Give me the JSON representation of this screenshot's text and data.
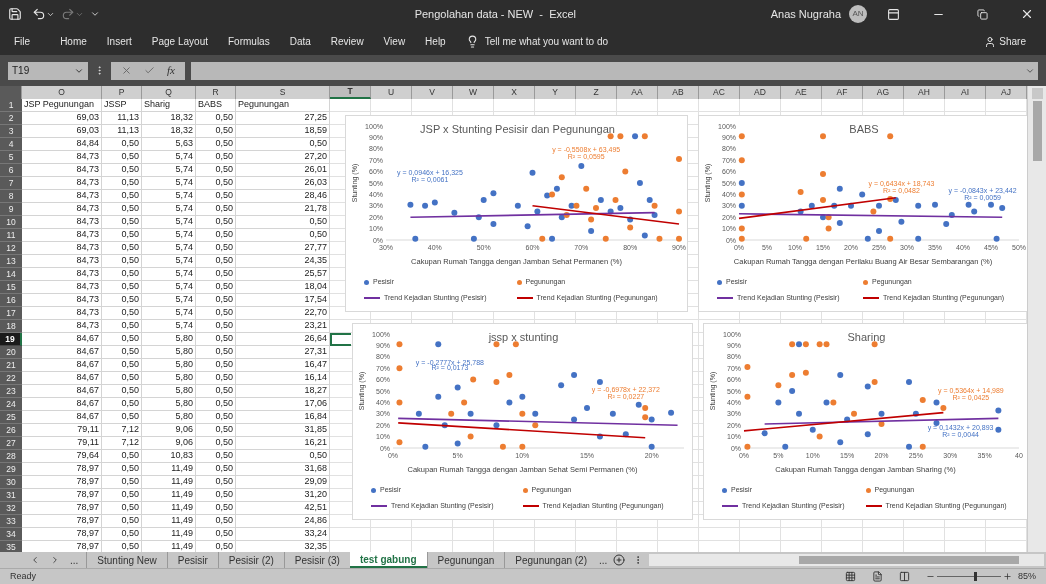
{
  "window": {
    "title": "Pengolahan data - NEW  -  Excel",
    "user": "Anas Nugraha",
    "user_initials": "AN"
  },
  "menu": [
    {
      "label": "File"
    },
    {
      "label": "Home"
    },
    {
      "label": "Insert"
    },
    {
      "label": "Page Layout"
    },
    {
      "label": "Formulas"
    },
    {
      "label": "Data"
    },
    {
      "label": "Review"
    },
    {
      "label": "View"
    },
    {
      "label": "Help"
    }
  ],
  "tell_me": {
    "placeholder": "Tell me what you want to do"
  },
  "share": "Share",
  "formula_bar": {
    "name_box": "T19",
    "function_label": "fx"
  },
  "columns": [
    {
      "label": "O",
      "selected": false
    },
    {
      "label": "P",
      "selected": false
    },
    {
      "label": "Q",
      "selected": false
    },
    {
      "label": "R",
      "selected": false
    },
    {
      "label": "S",
      "selected": false
    },
    {
      "label": "T",
      "selected": true
    },
    {
      "label": "U",
      "selected": false
    },
    {
      "label": "V",
      "selected": false
    },
    {
      "label": "W",
      "selected": false
    },
    {
      "label": "X",
      "selected": false
    },
    {
      "label": "Y",
      "selected": false
    },
    {
      "label": "Z",
      "selected": false
    },
    {
      "label": "AA",
      "selected": false
    },
    {
      "label": "AB",
      "selected": false
    },
    {
      "label": "AC",
      "selected": false
    },
    {
      "label": "AD",
      "selected": false
    },
    {
      "label": "AE",
      "selected": false
    },
    {
      "label": "AF",
      "selected": false
    },
    {
      "label": "AG",
      "selected": false
    },
    {
      "label": "AH",
      "selected": false
    },
    {
      "label": "AI",
      "selected": false
    },
    {
      "label": "AJ",
      "selected": false
    }
  ],
  "rows": [
    {
      "number": "1",
      "selected": false,
      "kind": "text",
      "cells": [
        "JSP Pegunungan",
        "JSSP",
        "Sharig",
        "BABS",
        "Pegunungan"
      ]
    },
    {
      "number": "2",
      "selected": false,
      "kind": "number",
      "cells": [
        "69,03",
        "11,13",
        "18,32",
        "0,50",
        "27,25"
      ]
    },
    {
      "number": "3",
      "selected": false,
      "kind": "number",
      "cells": [
        "69,03",
        "11,13",
        "18,32",
        "0,50",
        "18,59"
      ]
    },
    {
      "number": "4",
      "selected": false,
      "kind": "number",
      "cells": [
        "84,84",
        "0,50",
        "5,63",
        "0,50",
        "0,50"
      ]
    },
    {
      "number": "5",
      "selected": false,
      "kind": "number",
      "cells": [
        "84,73",
        "0,50",
        "5,74",
        "0,50",
        "27,20"
      ]
    },
    {
      "number": "6",
      "selected": false,
      "kind": "number",
      "cells": [
        "84,73",
        "0,50",
        "5,74",
        "0,50",
        "26,01"
      ]
    },
    {
      "number": "7",
      "selected": false,
      "kind": "number",
      "cells": [
        "84,73",
        "0,50",
        "5,74",
        "0,50",
        "26,03"
      ]
    },
    {
      "number": "8",
      "selected": false,
      "kind": "number",
      "cells": [
        "84,73",
        "0,50",
        "5,74",
        "0,50",
        "28,46"
      ]
    },
    {
      "number": "9",
      "selected": false,
      "kind": "number",
      "cells": [
        "84,73",
        "0,50",
        "5,74",
        "0,50",
        "21,78"
      ]
    },
    {
      "number": "10",
      "selected": false,
      "kind": "number",
      "cells": [
        "84,73",
        "0,50",
        "5,74",
        "0,50",
        "0,50"
      ]
    },
    {
      "number": "11",
      "selected": false,
      "kind": "number",
      "cells": [
        "84,73",
        "0,50",
        "5,74",
        "0,50",
        "0,50"
      ]
    },
    {
      "number": "12",
      "selected": false,
      "kind": "number",
      "cells": [
        "84,73",
        "0,50",
        "5,74",
        "0,50",
        "27,77"
      ]
    },
    {
      "number": "13",
      "selected": false,
      "kind": "number",
      "cells": [
        "84,73",
        "0,50",
        "5,74",
        "0,50",
        "24,35"
      ]
    },
    {
      "number": "14",
      "selected": false,
      "kind": "number",
      "cells": [
        "84,73",
        "0,50",
        "5,74",
        "0,50",
        "25,57"
      ]
    },
    {
      "number": "15",
      "selected": false,
      "kind": "number",
      "cells": [
        "84,73",
        "0,50",
        "5,74",
        "0,50",
        "18,04"
      ]
    },
    {
      "number": "16",
      "selected": false,
      "kind": "number",
      "cells": [
        "84,73",
        "0,50",
        "5,74",
        "0,50",
        "17,54"
      ]
    },
    {
      "number": "17",
      "selected": false,
      "kind": "number",
      "cells": [
        "84,73",
        "0,50",
        "5,74",
        "0,50",
        "22,70"
      ]
    },
    {
      "number": "18",
      "selected": false,
      "kind": "number",
      "cells": [
        "84,73",
        "0,50",
        "5,74",
        "0,50",
        "23,21"
      ]
    },
    {
      "number": "19",
      "selected": true,
      "kind": "number",
      "cells": [
        "84,67",
        "0,50",
        "5,80",
        "0,50",
        "26,64"
      ]
    },
    {
      "number": "20",
      "selected": false,
      "kind": "number",
      "cells": [
        "84,67",
        "0,50",
        "5,80",
        "0,50",
        "27,31"
      ]
    },
    {
      "number": "21",
      "selected": false,
      "kind": "number",
      "cells": [
        "84,67",
        "0,50",
        "5,80",
        "0,50",
        "16,47"
      ]
    },
    {
      "number": "22",
      "selected": false,
      "kind": "number",
      "cells": [
        "84,67",
        "0,50",
        "5,80",
        "0,50",
        "16,14"
      ]
    },
    {
      "number": "23",
      "selected": false,
      "kind": "number",
      "cells": [
        "84,67",
        "0,50",
        "5,80",
        "0,50",
        "18,27"
      ]
    },
    {
      "number": "24",
      "selected": false,
      "kind": "number",
      "cells": [
        "84,67",
        "0,50",
        "5,80",
        "0,50",
        "17,06"
      ]
    },
    {
      "number": "25",
      "selected": false,
      "kind": "number",
      "cells": [
        "84,67",
        "0,50",
        "5,80",
        "0,50",
        "16,84"
      ]
    },
    {
      "number": "26",
      "selected": false,
      "kind": "number",
      "cells": [
        "79,11",
        "7,12",
        "9,06",
        "0,50",
        "31,85"
      ]
    },
    {
      "number": "27",
      "selected": false,
      "kind": "number",
      "cells": [
        "79,11",
        "7,12",
        "9,06",
        "0,50",
        "16,21"
      ]
    },
    {
      "number": "28",
      "selected": false,
      "kind": "number",
      "cells": [
        "79,64",
        "0,50",
        "10,83",
        "0,50",
        "0,50"
      ]
    },
    {
      "number": "29",
      "selected": false,
      "kind": "number",
      "cells": [
        "78,97",
        "0,50",
        "11,49",
        "0,50",
        "31,68"
      ]
    },
    {
      "number": "30",
      "selected": false,
      "kind": "number",
      "cells": [
        "78,97",
        "0,50",
        "11,49",
        "0,50",
        "29,09"
      ]
    },
    {
      "number": "31",
      "selected": false,
      "kind": "number",
      "cells": [
        "78,97",
        "0,50",
        "11,49",
        "0,50",
        "31,20"
      ]
    },
    {
      "number": "32",
      "selected": false,
      "kind": "number",
      "cells": [
        "78,97",
        "0,50",
        "11,49",
        "0,50",
        "42,51"
      ]
    },
    {
      "number": "33",
      "selected": false,
      "kind": "number",
      "cells": [
        "78,97",
        "0,50",
        "11,49",
        "0,50",
        "24,86"
      ]
    },
    {
      "number": "34",
      "selected": false,
      "kind": "number",
      "cells": [
        "78,97",
        "0,50",
        "11,49",
        "0,50",
        "33,24"
      ]
    },
    {
      "number": "35",
      "selected": false,
      "kind": "number",
      "cells": [
        "78,97",
        "0,50",
        "11,49",
        "0,50",
        "32,35"
      ]
    }
  ],
  "charts": [
    {
      "chart_data": {
        "type": "scatter",
        "title": "JSP x Stunting Pesisir dan Pegunungan",
        "xlabel": "Cakupan Rumah Tangga dengan Jamban Sehat Permanen (%)",
        "ylabel": "Stunting (%)",
        "xlim": [
          30,
          90
        ],
        "ylim": [
          0,
          100
        ],
        "xticks": [
          {
            "value": 30,
            "label": "30%"
          },
          {
            "value": 40,
            "label": "40%"
          },
          {
            "value": 50,
            "label": "50%"
          },
          {
            "value": 60,
            "label": "60%"
          },
          {
            "value": 70,
            "label": "70%"
          },
          {
            "value": 80,
            "label": "80%"
          },
          {
            "value": 90,
            "label": "90%"
          }
        ],
        "yticks": [
          {
            "value": 0,
            "label": "0%"
          },
          {
            "value": 10,
            "label": "10%"
          },
          {
            "value": 20,
            "label": "20%"
          },
          {
            "value": 30,
            "label": "30%"
          },
          {
            "value": 40,
            "label": "40%"
          },
          {
            "value": 50,
            "label": "50%"
          },
          {
            "value": 60,
            "label": "60%"
          },
          {
            "value": 70,
            "label": "70%"
          },
          {
            "value": 80,
            "label": "80%"
          },
          {
            "value": 90,
            "label": "90%"
          },
          {
            "value": 100,
            "label": "100%"
          }
        ],
        "x": [
          35,
          36,
          38,
          40,
          44,
          48,
          49,
          50,
          52,
          52,
          57,
          59,
          60,
          61,
          63,
          65,
          66,
          68,
          70,
          72,
          74,
          76,
          78,
          80,
          81,
          82,
          83,
          84,
          85,
          64,
          62,
          64,
          66,
          67,
          69,
          71,
          73,
          75,
          76,
          77,
          78,
          79,
          80,
          83,
          85,
          86,
          90,
          90,
          90,
          72,
          35,
          85,
          60,
          90
        ],
        "series": [
          {
            "name": "Pesisir",
            "type": "scatter",
            "color": "#4472c4",
            "values": [
              31,
              1,
              30,
              33,
              24,
              1,
              20,
              35,
              41,
              14,
              30,
              12,
              59,
              25,
              39,
              45,
              20,
              30,
              65,
              8,
              35,
              25,
              28,
              18,
              91,
              50,
              4,
              35,
              22,
              1,
              null,
              null,
              null,
              null,
              null,
              null,
              null,
              null,
              null,
              null,
              null,
              null,
              null,
              null,
              null,
              null,
              null,
              null,
              null,
              null,
              null,
              null,
              null,
              null
            ]
          },
          {
            "name": "Pegunungan",
            "type": "scatter",
            "color": "#ed7d31",
            "values": [
              null,
              null,
              null,
              null,
              null,
              null,
              null,
              null,
              null,
              null,
              null,
              null,
              null,
              null,
              null,
              null,
              null,
              null,
              null,
              null,
              null,
              null,
              null,
              null,
              null,
              null,
              null,
              null,
              null,
              null,
              1,
              40,
              55,
              22,
              30,
              45,
              28,
              1,
              91,
              35,
              91,
              60,
              11,
              91,
              30,
              1,
              71,
              25,
              1,
              18,
              null,
              null,
              null,
              null
            ]
          },
          {
            "name": "Trend Kejadian Stunting (Pesisir)",
            "type": "line",
            "color": "#7030a0",
            "values": [
              null,
              null,
              null,
              null,
              null,
              null,
              null,
              null,
              null,
              null,
              null,
              null,
              null,
              null,
              null,
              null,
              null,
              null,
              null,
              null,
              null,
              null,
              null,
              null,
              null,
              null,
              null,
              null,
              null,
              null,
              null,
              null,
              null,
              null,
              null,
              null,
              null,
              null,
              null,
              null,
              null,
              null,
              null,
              null,
              null,
              null,
              null,
              null,
              null,
              null,
              20,
              24,
              null,
              null
            ]
          },
          {
            "name": "Trend Kejadian Stunting (Pegunungan)",
            "type": "line",
            "color": "#c00000",
            "values": [
              null,
              null,
              null,
              null,
              null,
              null,
              null,
              null,
              null,
              null,
              null,
              null,
              null,
              null,
              null,
              null,
              null,
              null,
              null,
              null,
              null,
              null,
              null,
              null,
              null,
              null,
              null,
              null,
              null,
              null,
              null,
              null,
              null,
              null,
              null,
              null,
              null,
              null,
              null,
              null,
              null,
              null,
              null,
              null,
              null,
              null,
              null,
              null,
              null,
              null,
              null,
              null,
              30,
              14
            ]
          }
        ],
        "annotations": [
          "y = 0,0946x + 16,325",
          "R² = 0,0061",
          "y = -0,5508x + 63,495",
          "R² = 0,0595"
        ]
      }
    },
    {
      "chart_data": {
        "type": "scatter",
        "title": "BABS",
        "xlabel": "Cakupan Rumah Tangga dengan Perilaku Buang Air Besar Sembarangan (%)",
        "ylabel": "Stunting (%)",
        "xlim": [
          0,
          50
        ],
        "ylim": [
          0,
          100
        ],
        "xticks": [
          {
            "value": 0,
            "label": "0%"
          },
          {
            "value": 5,
            "label": "5%"
          },
          {
            "value": 10,
            "label": "10%"
          },
          {
            "value": 15,
            "label": "15%"
          },
          {
            "value": 20,
            "label": "20%"
          },
          {
            "value": 25,
            "label": "25%"
          },
          {
            "value": 30,
            "label": "30%"
          },
          {
            "value": 35,
            "label": "35%"
          },
          {
            "value": 40,
            "label": "40%"
          },
          {
            "value": 45,
            "label": "45%"
          },
          {
            "value": 50,
            "label": "50%"
          }
        ],
        "yticks": [
          {
            "value": 0,
            "label": "0%"
          },
          {
            "value": 10,
            "label": "10%"
          },
          {
            "value": 20,
            "label": "20%"
          },
          {
            "value": 30,
            "label": "30%"
          },
          {
            "value": 40,
            "label": "40%"
          },
          {
            "value": 50,
            "label": "50%"
          },
          {
            "value": 60,
            "label": "60%"
          },
          {
            "value": 70,
            "label": "70%"
          },
          {
            "value": 80,
            "label": "80%"
          },
          {
            "value": 90,
            "label": "90%"
          },
          {
            "value": 100,
            "label": "100%"
          }
        ],
        "x": [
          0.5,
          0.5,
          11,
          13,
          15,
          17,
          18,
          18,
          20,
          22,
          23,
          25,
          25,
          28,
          29,
          32,
          32,
          35,
          37,
          38,
          41,
          42,
          45,
          46,
          47,
          0.5,
          0.5,
          0.5,
          0.5,
          0.5,
          11,
          12,
          15,
          15,
          15,
          16,
          16,
          24,
          27,
          27,
          27,
          0,
          47,
          0,
          28
        ],
        "series": [
          {
            "name": "Pesisir",
            "type": "scatter",
            "color": "#4472c4",
            "values": [
              50,
              30,
              25,
              30,
              20,
              30,
              45,
              15,
              30,
              40,
              1,
              30,
              8,
              35,
              16,
              30,
              1,
              31,
              14,
              22,
              31,
              25,
              31,
              1,
              28,
              null,
              null,
              null,
              null,
              null,
              null,
              null,
              null,
              null,
              null,
              null,
              null,
              null,
              null,
              null,
              null,
              null,
              null,
              null,
              null
            ]
          },
          {
            "name": "Pegunungan",
            "type": "scatter",
            "color": "#ed7d31",
            "values": [
              null,
              null,
              null,
              null,
              null,
              null,
              null,
              null,
              null,
              null,
              null,
              null,
              null,
              null,
              null,
              null,
              null,
              null,
              null,
              null,
              null,
              null,
              null,
              null,
              null,
              91,
              70,
              40,
              10,
              1,
              42,
              1,
              91,
              58,
              35,
              20,
              10,
              25,
              91,
              36,
              1,
              null,
              null,
              null,
              null
            ]
          },
          {
            "name": "Trend Kejadian Stunting (Pesisir)",
            "type": "line",
            "color": "#7030a0",
            "values": [
              null,
              null,
              null,
              null,
              null,
              null,
              null,
              null,
              null,
              null,
              null,
              null,
              null,
              null,
              null,
              null,
              null,
              null,
              null,
              null,
              null,
              null,
              null,
              null,
              null,
              null,
              null,
              null,
              null,
              null,
              null,
              null,
              null,
              null,
              null,
              null,
              null,
              null,
              null,
              null,
              null,
              23,
              20,
              null,
              null
            ]
          },
          {
            "name": "Trend Kejadian Stunting (Pegunungan)",
            "type": "line",
            "color": "#c00000",
            "values": [
              null,
              null,
              null,
              null,
              null,
              null,
              null,
              null,
              null,
              null,
              null,
              null,
              null,
              null,
              null,
              null,
              null,
              null,
              null,
              null,
              null,
              null,
              null,
              null,
              null,
              null,
              null,
              null,
              null,
              null,
              null,
              null,
              null,
              null,
              null,
              null,
              null,
              null,
              null,
              null,
              null,
              null,
              null,
              19,
              37
            ]
          }
        ],
        "annotations": [
          "y = 0,6434x + 18,743",
          "R² = 0,0482",
          "y = -0,0843x + 23,442",
          "R² = 0,0059"
        ]
      }
    },
    {
      "chart_data": {
        "type": "scatter",
        "title": "jssp x stunting",
        "xlabel": "Cakupan Rumah Tangga dengan Jamban Sehat Semi Permanen (%)",
        "ylabel": "Stunting (%)",
        "xlim": [
          0,
          22.5
        ],
        "ylim": [
          0,
          100
        ],
        "xticks": [
          {
            "value": 0,
            "label": "0%"
          },
          {
            "value": 5,
            "label": "5%"
          },
          {
            "value": 10,
            "label": "10%"
          },
          {
            "value": 15,
            "label": "15%"
          },
          {
            "value": 20,
            "label": "20%"
          }
        ],
        "yticks": [
          {
            "value": 0,
            "label": "0%"
          },
          {
            "value": 10,
            "label": "10%"
          },
          {
            "value": 20,
            "label": "20%"
          },
          {
            "value": 30,
            "label": "30%"
          },
          {
            "value": 40,
            "label": "40%"
          },
          {
            "value": 50,
            "label": "50%"
          },
          {
            "value": 60,
            "label": "60%"
          },
          {
            "value": 70,
            "label": "70%"
          },
          {
            "value": 80,
            "label": "80%"
          },
          {
            "value": 90,
            "label": "90%"
          },
          {
            "value": 100,
            "label": "100%"
          }
        ],
        "x": [
          2,
          2.5,
          3.5,
          3.5,
          4,
          5,
          5,
          6,
          8,
          9,
          10,
          11,
          13,
          14,
          14,
          15,
          16,
          16,
          17,
          18,
          19,
          20,
          20,
          21.5,
          0.5,
          0.5,
          0.5,
          0.5,
          4.5,
          6.2,
          5.5,
          6,
          8,
          8,
          8.5,
          9.5,
          9,
          10,
          10,
          11,
          19.5,
          19.5,
          0.4,
          22,
          0.4,
          19.5
        ],
        "series": [
          {
            "name": "Pesisir",
            "type": "scatter",
            "color": "#4472c4",
            "values": [
              30,
              1,
              91,
              45,
              20,
              53,
              4,
              30,
              20,
              40,
              45,
              30,
              55,
              64,
              25,
              35,
              58,
              10,
              30,
              12,
              38,
              25,
              1,
              31,
              null,
              null,
              null,
              null,
              null,
              null,
              null,
              null,
              null,
              null,
              null,
              null,
              null,
              null,
              null,
              null,
              null,
              null,
              null,
              null,
              null,
              null
            ]
          },
          {
            "name": "Pegunungan",
            "type": "scatter",
            "color": "#ed7d31",
            "values": [
              null,
              null,
              null,
              null,
              null,
              null,
              null,
              null,
              null,
              null,
              null,
              null,
              null,
              null,
              null,
              null,
              null,
              null,
              null,
              null,
              null,
              null,
              null,
              null,
              91,
              70,
              40,
              5,
              30,
              60,
              40,
              10,
              91,
              58,
              1,
              91,
              64,
              30,
              1,
              20,
              35,
              27,
              null,
              null,
              null,
              null
            ]
          },
          {
            "name": "Trend Kejadian Stunting (Pesisir)",
            "type": "line",
            "color": "#7030a0",
            "values": [
              null,
              null,
              null,
              null,
              null,
              null,
              null,
              null,
              null,
              null,
              null,
              null,
              null,
              null,
              null,
              null,
              null,
              null,
              null,
              null,
              null,
              null,
              null,
              null,
              null,
              null,
              null,
              null,
              null,
              null,
              null,
              null,
              null,
              null,
              null,
              null,
              null,
              null,
              null,
              null,
              null,
              null,
              26,
              20,
              null,
              null
            ]
          },
          {
            "name": "Trend Kejadian Stunting (Pegunungan)",
            "type": "line",
            "color": "#c00000",
            "values": [
              null,
              null,
              null,
              null,
              null,
              null,
              null,
              null,
              null,
              null,
              null,
              null,
              null,
              null,
              null,
              null,
              null,
              null,
              null,
              null,
              null,
              null,
              null,
              null,
              null,
              null,
              null,
              null,
              null,
              null,
              null,
              null,
              null,
              null,
              null,
              null,
              null,
              null,
              null,
              null,
              null,
              null,
              null,
              null,
              22,
              9
            ]
          }
        ],
        "annotations": [
          "y = -0,2777x + 25,788",
          "R² = 0,0173",
          "y = -0,6978x + 22,372",
          "R² = 0,0227"
        ]
      }
    },
    {
      "chart_data": {
        "type": "scatter",
        "title": "Sharing",
        "xlabel": "Cakupan Rumah Tangga dengan Jamban Sharing (%)",
        "ylabel": "Stunting (%)",
        "xlim": [
          0,
          40
        ],
        "ylim": [
          0,
          100
        ],
        "xticks": [
          {
            "value": 0,
            "label": "0%"
          },
          {
            "value": 5,
            "label": "5%"
          },
          {
            "value": 10,
            "label": "10%"
          },
          {
            "value": 15,
            "label": "15%"
          },
          {
            "value": 20,
            "label": "20%"
          },
          {
            "value": 25,
            "label": "25%"
          },
          {
            "value": 30,
            "label": "30%"
          },
          {
            "value": 35,
            "label": "35%"
          },
          {
            "value": 40,
            "label": "40"
          }
        ],
        "yticks": [
          {
            "value": 0,
            "label": "0%"
          },
          {
            "value": 10,
            "label": "10%"
          },
          {
            "value": 20,
            "label": "20%"
          },
          {
            "value": 30,
            "label": "30%"
          },
          {
            "value": 40,
            "label": "40%"
          },
          {
            "value": 50,
            "label": "50%"
          },
          {
            "value": 60,
            "label": "60%"
          },
          {
            "value": 70,
            "label": "70%"
          },
          {
            "value": 80,
            "label": "80%"
          },
          {
            "value": 90,
            "label": "90%"
          },
          {
            "value": 100,
            "label": "100%"
          }
        ],
        "x": [
          3,
          5,
          6,
          7,
          8,
          8,
          10,
          12,
          14,
          14,
          15,
          18,
          18,
          20,
          24,
          24,
          25,
          28,
          28,
          37,
          37,
          0.5,
          0.5,
          0.5,
          5,
          7,
          7,
          9,
          9,
          11,
          11,
          12,
          13,
          16,
          19,
          19,
          20,
          26,
          26,
          29,
          3,
          37,
          0,
          29
        ],
        "series": [
          {
            "name": "Pesisir",
            "type": "scatter",
            "color": "#4472c4",
            "values": [
              13,
              40,
              1,
              50,
              91,
              30,
              16,
              40,
              64,
              5,
              25,
              54,
              12,
              30,
              58,
              1,
              30,
              40,
              22,
              33,
              16,
              null,
              null,
              null,
              null,
              null,
              null,
              null,
              null,
              null,
              null,
              null,
              null,
              null,
              null,
              null,
              null,
              null,
              null,
              null,
              null,
              null,
              null,
              null
            ]
          },
          {
            "name": "Pegunungan",
            "type": "scatter",
            "color": "#ed7d31",
            "values": [
              null,
              null,
              null,
              null,
              null,
              null,
              null,
              null,
              null,
              null,
              null,
              null,
              null,
              null,
              null,
              null,
              null,
              null,
              null,
              null,
              null,
              71,
              45,
              1,
              55,
              91,
              64,
              91,
              66,
              91,
              10,
              91,
              40,
              30,
              91,
              58,
              21,
              42,
              1,
              35,
              null,
              null,
              null,
              null
            ]
          },
          {
            "name": "Trend Kejadian Stunting (Pesisir)",
            "type": "line",
            "color": "#7030a0",
            "values": [
              null,
              null,
              null,
              null,
              null,
              null,
              null,
              null,
              null,
              null,
              null,
              null,
              null,
              null,
              null,
              null,
              null,
              null,
              null,
              null,
              null,
              null,
              null,
              null,
              null,
              null,
              null,
              null,
              null,
              null,
              null,
              null,
              null,
              null,
              null,
              null,
              null,
              null,
              null,
              null,
              21,
              26,
              null,
              null
            ]
          },
          {
            "name": "Trend Kejadian Stunting (Pegunungan)",
            "type": "line",
            "color": "#c00000",
            "values": [
              null,
              null,
              null,
              null,
              null,
              null,
              null,
              null,
              null,
              null,
              null,
              null,
              null,
              null,
              null,
              null,
              null,
              null,
              null,
              null,
              null,
              null,
              null,
              null,
              null,
              null,
              null,
              null,
              null,
              null,
              null,
              null,
              null,
              null,
              null,
              null,
              null,
              null,
              null,
              null,
              null,
              null,
              15,
              31
            ]
          }
        ],
        "annotations": [
          "y = 0,5364x + 14,989",
          "R² = 0,0425",
          "y = 0,1432x + 20,893",
          "R² = 0,0044"
        ]
      }
    }
  ],
  "sheet_tabs": [
    {
      "label": "Stunting New",
      "selected": false
    },
    {
      "label": "Pesisir",
      "selected": false
    },
    {
      "label": "Pesisir (2)",
      "selected": false
    },
    {
      "label": "Pesisir (3)",
      "selected": false
    },
    {
      "label": "test gabung",
      "selected": true
    },
    {
      "label": "Pegunungan",
      "selected": false
    },
    {
      "label": "Pegunungan (2)",
      "selected": false
    }
  ],
  "tabs_more_left": "...",
  "tabs_more_right": "...",
  "status_bar": {
    "text": "Ready",
    "zoom": {
      "level": 0.6,
      "reading": "85%"
    }
  }
}
